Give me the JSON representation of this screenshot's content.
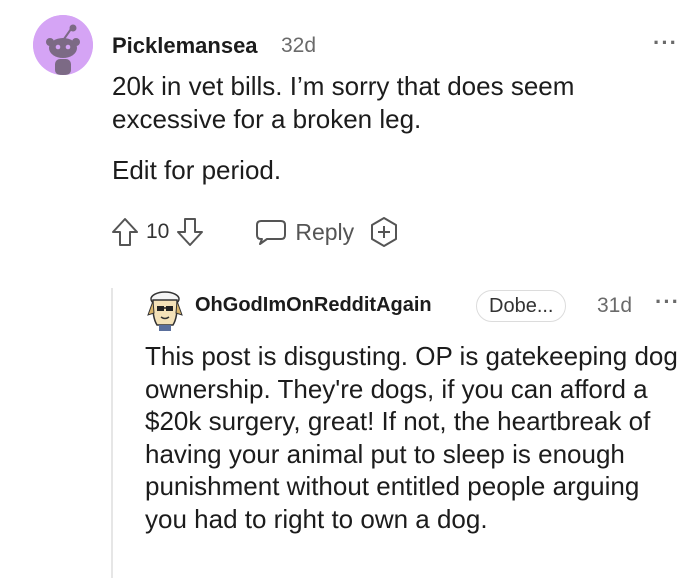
{
  "parent_comment": {
    "author": "Picklemansea",
    "time": "32d",
    "body_lines": [
      "20k in vet bills. I’m sorry that does seem excessive for a broken leg.",
      "Edit for period."
    ],
    "vote_count": "10",
    "reply_label": "Reply"
  },
  "child_comment": {
    "author": "OhGodImOnRedditAgain",
    "flair": "Dobe...",
    "time": "31d",
    "body": "This post is disgusting. OP is gatekeeping dog ownership. They're dogs, if you can afford a $20k surgery, great! If not, the heartbreak of having your animal put to sleep is enough punishment without entitled people arguing you had to right to own a dog."
  },
  "more_options": "···",
  "icons": {
    "avatar_parent": "snoo-avatar-icon",
    "avatar_child": "custom-avatar-icon",
    "upvote": "upvote-arrow-icon",
    "downvote": "downvote-arrow-icon",
    "reply": "speech-bubble-icon",
    "award": "add-award-icon"
  },
  "colors": {
    "avatar_bg": "#d5a4f5",
    "muted_text": "#6a6a6a",
    "thread_line": "#e6e6e6"
  }
}
